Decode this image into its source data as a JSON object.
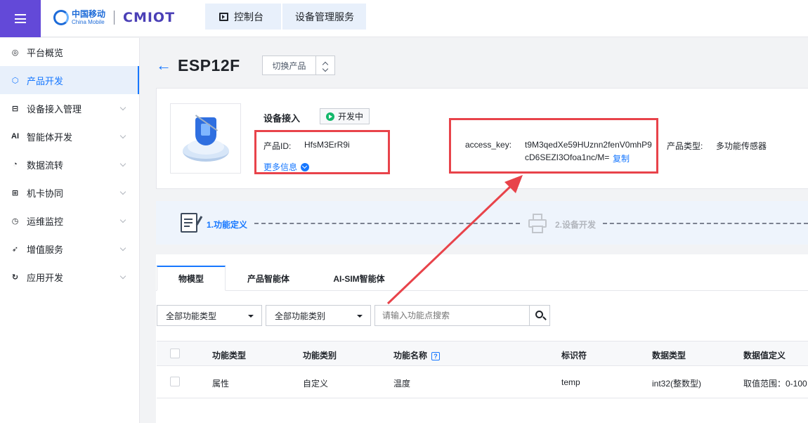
{
  "header": {
    "logo_cn": "中国移动",
    "logo_en": "China Mobile",
    "logo_brand": "CMIOT",
    "breadcrumb": [
      "控制台",
      "设备管理服务"
    ]
  },
  "sidebar": {
    "items": [
      {
        "label": "平台概览",
        "icon": "platform-icon"
      },
      {
        "label": "产品开发",
        "icon": "cube-icon"
      },
      {
        "label": "设备接入管理",
        "icon": "device-access-icon"
      },
      {
        "label": "智能体开发",
        "icon": "ai-icon"
      },
      {
        "label": "数据流转",
        "icon": "data-flow-icon"
      },
      {
        "label": "机卡协同",
        "icon": "card-sync-icon"
      },
      {
        "label": "运维监控",
        "icon": "monitor-icon"
      },
      {
        "label": "增值服务",
        "icon": "value-added-icon"
      },
      {
        "label": "应用开发",
        "icon": "app-dev-icon"
      }
    ],
    "active_index": 1,
    "ai_glyph": "AI"
  },
  "product": {
    "back_icon": "←",
    "name": "ESP12F",
    "switch_label": "切换产品",
    "access_label": "设备接入",
    "status": "开发中",
    "status_color": "#12b76a",
    "id_label": "产品ID:",
    "id_value": "HfsM3ErR9i",
    "more_info": "更多信息",
    "access_key_label": "access_key:",
    "access_key_line1": "t9M3qedXe59HUznn2fenV0mhP9",
    "access_key_line2": "cD6SEZI3Ofoa1nc/M=",
    "copy_label": "复制",
    "type_label": "产品类型:",
    "type_value": "多功能传感器"
  },
  "steps": [
    {
      "label": "1.功能定义",
      "state": "active"
    },
    {
      "label": "2.设备开发",
      "state": "inactive"
    }
  ],
  "tabs": [
    {
      "label": "物模型",
      "active": true
    },
    {
      "label": "产品智能体",
      "active": false
    },
    {
      "label": "AI-SIM智能体",
      "active": false
    }
  ],
  "filters": {
    "type_select": "全部功能类型",
    "category_select": "全部功能类别",
    "search_placeholder": "请输入功能点搜索"
  },
  "table": {
    "headers": [
      "功能类型",
      "功能类别",
      "功能名称",
      "标识符",
      "数据类型",
      "数据值定义"
    ],
    "help_glyph": "?",
    "rows": [
      [
        "属性",
        "自定义",
        "温度",
        "temp",
        "int32(整数型)",
        "取值范围：0-100"
      ]
    ]
  },
  "colors": {
    "accent": "#1677ff",
    "menu_bg": "#6349d8",
    "highlight": "#e8434a"
  }
}
